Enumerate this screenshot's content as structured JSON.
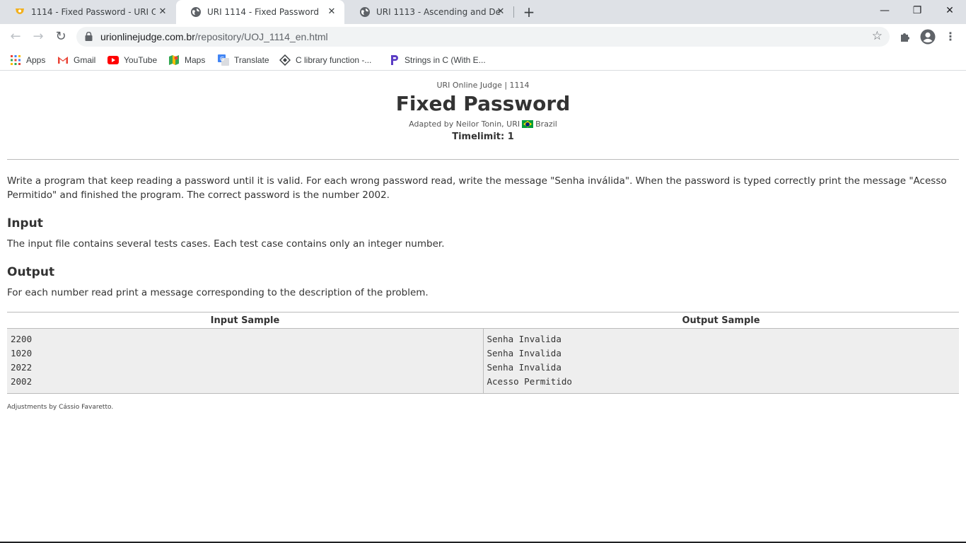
{
  "browser": {
    "tabs": [
      {
        "title": "1114 - Fixed Password - URI Onli",
        "icon": "uri-favicon",
        "active": false
      },
      {
        "title": "URI 1114 - Fixed Password",
        "icon": "globe-icon",
        "active": true
      },
      {
        "title": "URI 1113 - Ascending and Desce",
        "icon": "globe-icon",
        "active": false
      }
    ],
    "window_controls": {
      "minimize": "—",
      "restore": "❐",
      "close": "✕"
    },
    "url": {
      "host": "urionlinejudge.com.br",
      "path": "/repository/UOJ_1114_en.html"
    },
    "bookmarks": [
      {
        "label": "Apps",
        "icon": "apps-grid-icon"
      },
      {
        "label": "Gmail",
        "icon": "gmail-icon"
      },
      {
        "label": "YouTube",
        "icon": "youtube-icon"
      },
      {
        "label": "Maps",
        "icon": "maps-icon"
      },
      {
        "label": "Translate",
        "icon": "translate-icon"
      },
      {
        "label": "C library function -...",
        "icon": "diamond-icon"
      },
      {
        "label": "Strings in C (With E...",
        "icon": "programiz-icon"
      }
    ],
    "accent_colors": {
      "tabstrip": "#dee1e6",
      "omnibox": "#f1f3f4"
    }
  },
  "problem": {
    "breadcrumb": "URI Online Judge | 1114",
    "title": "Fixed Password",
    "adapted_by": "Adapted by Neilor Tonin, URI",
    "country": "Brazil",
    "timelimit": "Timelimit: 1",
    "description": "Write a program that keep reading a password until it is valid. For each wrong password read, write the message \"Senha inválida\". When the password is typed correctly print the message \"Acesso Permitido\" and finished the program. The correct password is the number 2002.",
    "input_heading": "Input",
    "input_text": "The input file contains several tests cases. Each test case contains only an integer number.",
    "output_heading": "Output",
    "output_text": "For each number read print a message corresponding to the description of the problem.",
    "samples": {
      "input_header": "Input Sample",
      "output_header": "Output Sample",
      "input_lines": [
        "2200",
        "1020",
        "2022",
        "2002"
      ],
      "output_lines": [
        "Senha Invalida",
        "Senha Invalida",
        "Senha Invalida",
        "Acesso Permitido"
      ]
    },
    "adjustments": "Adjustments by Cássio Favaretto."
  }
}
